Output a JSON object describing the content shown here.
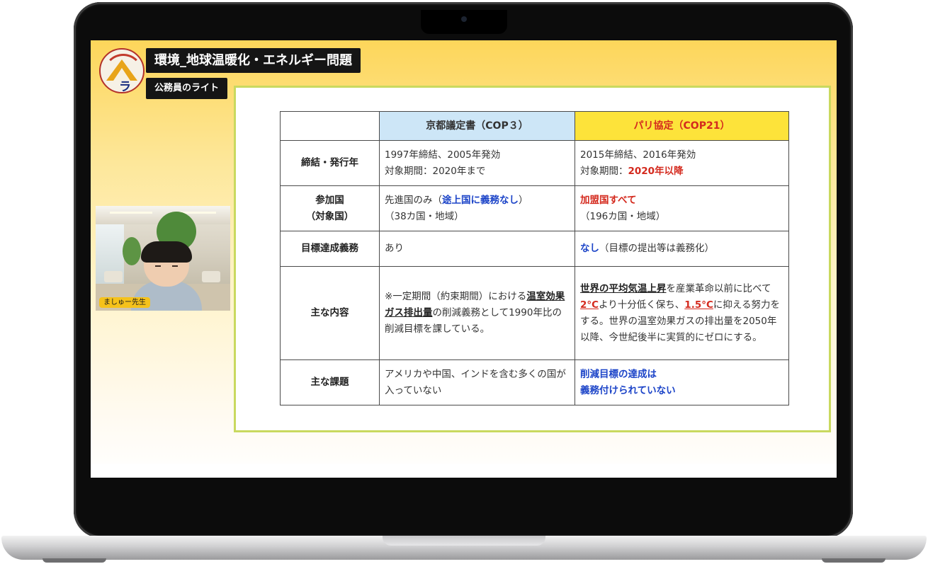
{
  "header": {
    "title": "環境_地球温暖化・エネルギー問題",
    "channel": "公務員のライト",
    "logo_text": "ラ"
  },
  "webcam": {
    "label": "ましゅー先生"
  },
  "table": {
    "headers": {
      "kyoto": "京都議定書（COP３）",
      "paris": "パリ協定（COP21）"
    },
    "rows": {
      "year": {
        "label": "締結・発行年",
        "kyoto_line1": "1997年締結、2005年発効",
        "kyoto_line2": "対象期間：2020年まで",
        "paris_line1": "2015年締結、2016年発効",
        "paris_line2_prefix": "対象期間：",
        "paris_line2_red": "2020年以降"
      },
      "countries": {
        "label_line1": "参加国",
        "label_line2": "（対象国）",
        "kyoto_prefix": "先進国のみ（",
        "kyoto_blue": "途上国に義務なし",
        "kyoto_suffix": "）",
        "kyoto_line2": "（38カ国・地域）",
        "paris_red": "加盟国すべて",
        "paris_line2": "（196カ国・地域）"
      },
      "obligation": {
        "label": "目標達成義務",
        "kyoto": "あり",
        "paris_blue": "なし",
        "paris_rest": "（目標の提出等は義務化）"
      },
      "content": {
        "label": "主な内容",
        "kyoto_pre": "※一定期間（約束期間）における",
        "kyoto_ul": "温室効果ガス排出量",
        "kyoto_post": "の削減義務として1990年比の削減目標を課している。",
        "paris_ul1": "世界の平均気温上昇",
        "paris_t1": "を産業革命以前に比べて",
        "paris_red1": "2°C",
        "paris_t2": "より十分低く保ち、",
        "paris_red2": "1.5°C",
        "paris_t3": "に抑える努力をする。世界の温室効果ガスの排出量を2050年以降、今世紀後半に実質的にゼロにする。"
      },
      "issues": {
        "label": "主な課題",
        "kyoto": "アメリカや中国、インドを含む多くの国が入っていない",
        "paris_line1": "削減目標の達成は",
        "paris_line2": "義務付けられていない"
      }
    }
  }
}
